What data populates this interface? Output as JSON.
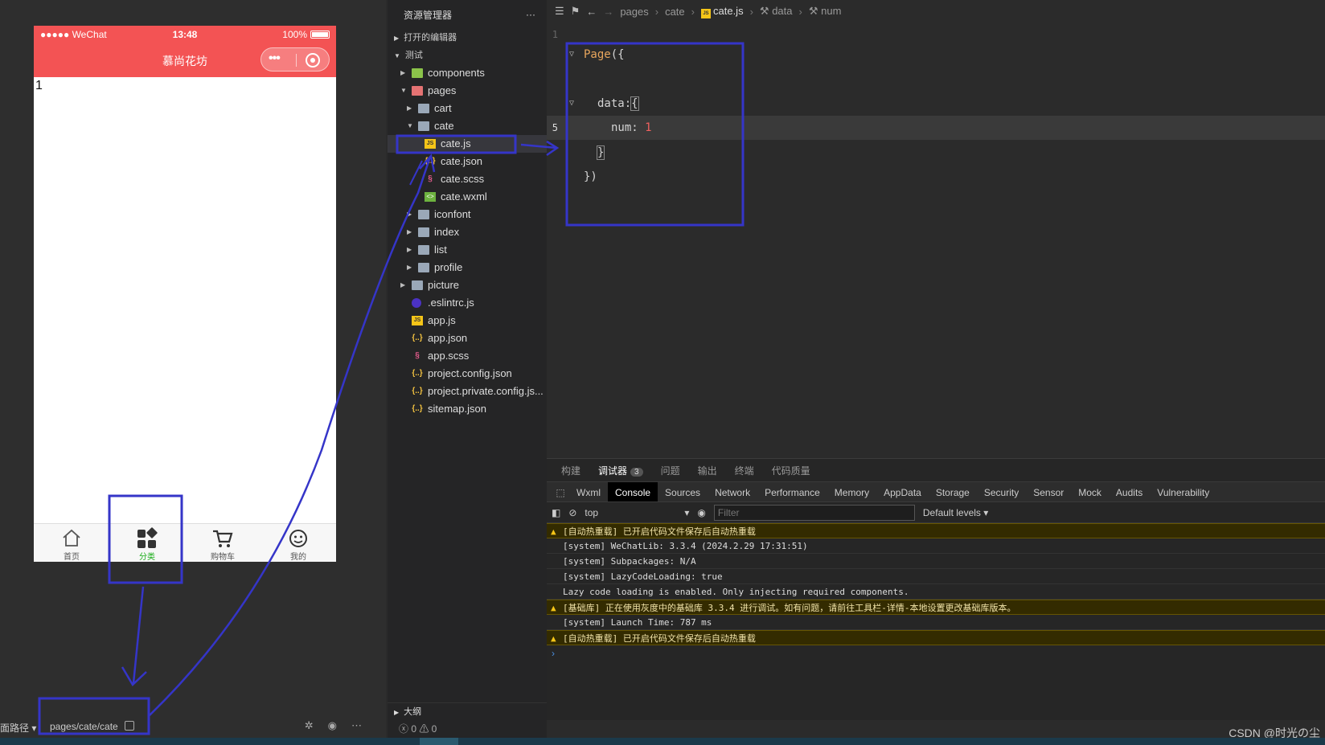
{
  "simulator": {
    "status": {
      "carrier": "●●●●● WeChat",
      "time": "13:48",
      "battery": "100%"
    },
    "nav_title": "慕尚花坊",
    "page_text": "1",
    "tabs": [
      {
        "label": "首页",
        "icon": "home-icon"
      },
      {
        "label": "分类",
        "icon": "category-icon",
        "active": true
      },
      {
        "label": "购物车",
        "icon": "cart-icon"
      },
      {
        "label": "我的",
        "icon": "profile-icon"
      }
    ],
    "footer": {
      "path_prefix": "面路径 ▾",
      "page_path": "pages/cate/cate"
    }
  },
  "explorer": {
    "title": "资源管理器",
    "more": "···",
    "open_editors": "打开的编辑器",
    "project": "测试",
    "outline": "大纲",
    "status": "ⓧ 0 ⚠ 0",
    "tree": [
      {
        "label": "components",
        "type": "folder-green",
        "depth": 1,
        "twisty": "▶"
      },
      {
        "label": "pages",
        "type": "folder-red",
        "depth": 1,
        "twisty": "▼"
      },
      {
        "label": "cart",
        "type": "folder",
        "depth": 2,
        "twisty": "▶"
      },
      {
        "label": "cate",
        "type": "folder",
        "depth": 2,
        "twisty": "▼"
      },
      {
        "label": "cate.js",
        "type": "js",
        "depth": 3,
        "selected": true
      },
      {
        "label": "cate.json",
        "type": "json",
        "depth": 3
      },
      {
        "label": "cate.scss",
        "type": "scss",
        "depth": 3
      },
      {
        "label": "cate.wxml",
        "type": "wxml",
        "depth": 3
      },
      {
        "label": "iconfont",
        "type": "folder",
        "depth": 2,
        "twisty": "▶"
      },
      {
        "label": "index",
        "type": "folder",
        "depth": 2,
        "twisty": "▶"
      },
      {
        "label": "list",
        "type": "folder",
        "depth": 2,
        "twisty": "▶"
      },
      {
        "label": "profile",
        "type": "folder",
        "depth": 2,
        "twisty": "▶"
      },
      {
        "label": "picture",
        "type": "folder",
        "depth": 1,
        "twisty": "▶"
      },
      {
        "label": ".eslintrc.js",
        "type": "eslint",
        "depth": 1
      },
      {
        "label": "app.js",
        "type": "js",
        "depth": 1
      },
      {
        "label": "app.json",
        "type": "json",
        "depth": 1
      },
      {
        "label": "app.scss",
        "type": "scss",
        "depth": 1
      },
      {
        "label": "project.config.json",
        "type": "json",
        "depth": 1
      },
      {
        "label": "project.private.config.js...",
        "type": "json",
        "depth": 1
      },
      {
        "label": "sitemap.json",
        "type": "json",
        "depth": 1
      }
    ]
  },
  "editor": {
    "breadcrumb": {
      "p1": "pages",
      "p2": "cate",
      "file": "cate.js",
      "sym1": "data",
      "sym2": "num"
    },
    "line_numbers": {
      "l1": "1",
      "l5": "5"
    },
    "code": {
      "l2_fn": "Page",
      "l2_punc": "({",
      "l4_prop": "data",
      "l4_punc": ":",
      "l4_brace": "{",
      "l5_prop": "num",
      "l5_punc": ": ",
      "l5_num": "1",
      "l6_brace": "}",
      "l7": "})"
    }
  },
  "debug": {
    "tabs": [
      "构建",
      "调试器",
      "问题",
      "输出",
      "终端",
      "代码质量"
    ],
    "debugger_badge": "3",
    "devtools_tabs": [
      "Wxml",
      "Console",
      "Sources",
      "Network",
      "Performance",
      "Memory",
      "AppData",
      "Storage",
      "Security",
      "Sensor",
      "Mock",
      "Audits",
      "Vulnerability"
    ],
    "context": "top",
    "filter_placeholder": "Filter",
    "levels": "Default levels ▾",
    "logs": [
      {
        "text": "[自动热重载] 已开启代码文件保存后自动热重载",
        "warn": true
      },
      {
        "text": "[system] WeChatLib: 3.3.4 (2024.2.29 17:31:51)",
        "warn": false
      },
      {
        "text": "[system] Subpackages: N/A",
        "warn": false
      },
      {
        "text": "[system] LazyCodeLoading: true",
        "warn": false
      },
      {
        "text": "Lazy code loading is enabled. Only injecting required components.",
        "warn": false
      },
      {
        "text": "[基础库] 正在使用灰度中的基础库 3.3.4 进行调试。如有问题，请前往工具栏-详情-本地设置更改基础库版本。",
        "warn": true
      },
      {
        "text": "[system] Launch Time: 787 ms",
        "warn": false
      },
      {
        "text": "[自动热重载] 已开启代码文件保存后自动热重载",
        "warn": true
      }
    ],
    "prompt": "›"
  },
  "watermark": "CSDN @时光の尘",
  "colors": {
    "nav_red": "#f35354",
    "annotation_blue": "#3535c8",
    "active_green": "#1aad19"
  }
}
